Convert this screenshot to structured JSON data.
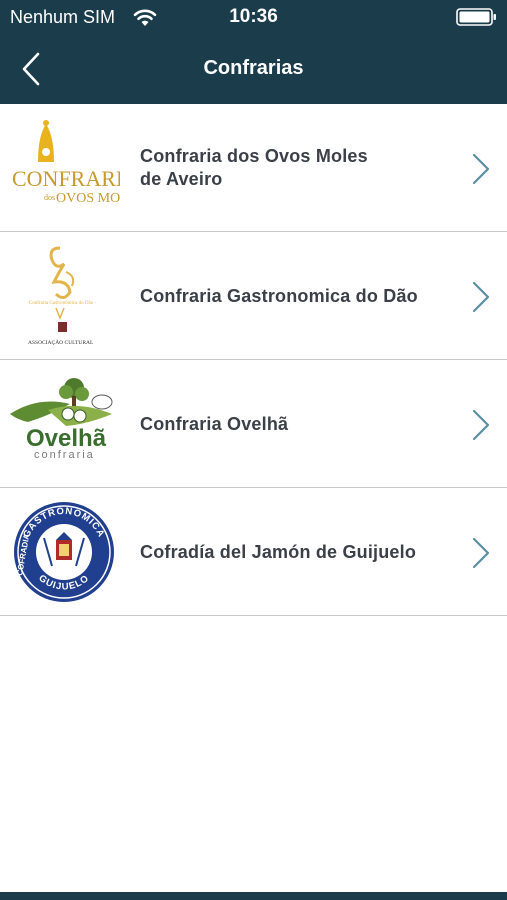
{
  "status_bar": {
    "carrier": "Nenhum SIM",
    "time": "10:36",
    "wifi_icon": "wifi-icon",
    "battery_icon": "battery-icon"
  },
  "nav": {
    "title": "Confrarias",
    "back_icon": "chevron-left-icon"
  },
  "colors": {
    "nav_background": "#1b3d4b",
    "text": "#3a3f48",
    "chevron": "#5a8fa3",
    "separator": "#c8c8cc"
  },
  "list": {
    "items": [
      {
        "label": "Confraria dos Ovos Moles\nde Aveiro",
        "logo_text_main": "CONFRARIA",
        "logo_text_small": "dos",
        "logo_text_sub": "OVOS MOLES",
        "chevron_icon": "chevron-right-icon"
      },
      {
        "label": "Confraria Gastronomica do Dão",
        "logo_text_bottom": "ASSOCIAÇÃO CULTURAL",
        "chevron_icon": "chevron-right-icon"
      },
      {
        "label": "Confraria Ovelhã",
        "logo_text_main": "Ovelhã",
        "logo_text_sub": "confraria",
        "chevron_icon": "chevron-right-icon"
      },
      {
        "label": "Cofradía del Jamón de Guijuelo",
        "logo_text_top": "GASTRONOMICA",
        "logo_text_left": "COFRADIA",
        "logo_text_bottom": "GUIJUELO",
        "chevron_icon": "chevron-right-icon"
      }
    ]
  }
}
